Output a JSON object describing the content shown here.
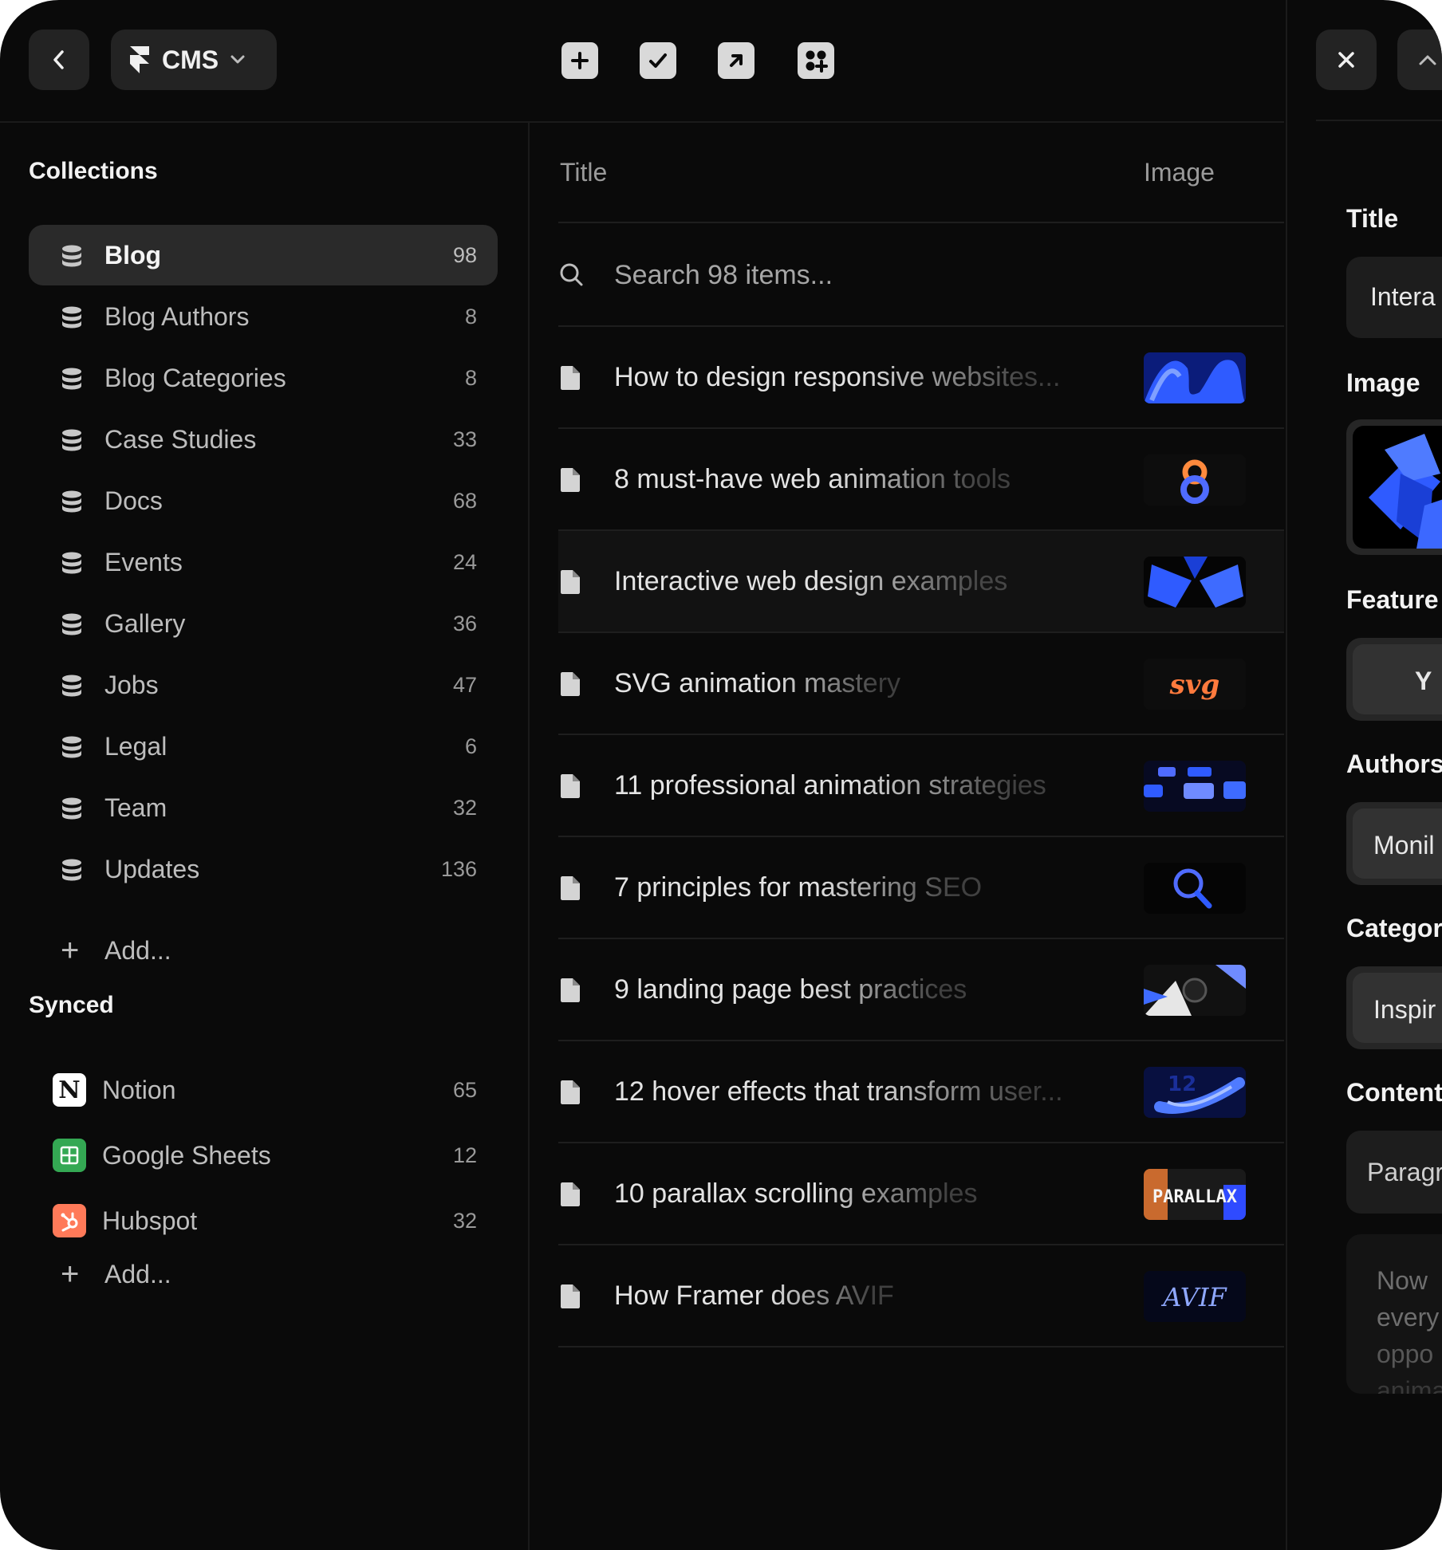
{
  "topbar": {
    "cms_label": "CMS"
  },
  "sidebar": {
    "collections_title": "Collections",
    "collections": [
      {
        "label": "Blog",
        "count": "98",
        "active": true
      },
      {
        "label": "Blog Authors",
        "count": "8"
      },
      {
        "label": "Blog Categories",
        "count": "8"
      },
      {
        "label": "Case Studies",
        "count": "33"
      },
      {
        "label": "Docs",
        "count": "68"
      },
      {
        "label": "Events",
        "count": "24"
      },
      {
        "label": "Gallery",
        "count": "36"
      },
      {
        "label": "Jobs",
        "count": "47"
      },
      {
        "label": "Legal",
        "count": "6"
      },
      {
        "label": "Team",
        "count": "32"
      },
      {
        "label": "Updates",
        "count": "136"
      }
    ],
    "add_collection_label": "Add...",
    "synced_title": "Synced",
    "synced": [
      {
        "label": "Notion",
        "count": "65",
        "icon": "notion-icon"
      },
      {
        "label": "Google Sheets",
        "count": "12",
        "icon": "google-sheets-icon"
      },
      {
        "label": "Hubspot",
        "count": "32",
        "icon": "hubspot-icon"
      }
    ],
    "add_synced_label": "Add..."
  },
  "main": {
    "columns": {
      "title": "Title",
      "image": "Image"
    },
    "search_placeholder": "Search 98 items...",
    "items": [
      {
        "title": "How to design responsive websites..."
      },
      {
        "title": "8 must-have web animation tools"
      },
      {
        "title": "Interactive web design examples",
        "highlighted": true
      },
      {
        "title": "SVG animation mastery"
      },
      {
        "title": "11 professional animation strategies"
      },
      {
        "title": "7 principles for mastering SEO"
      },
      {
        "title": "9 landing page best practices"
      },
      {
        "title": "12 hover effects that transform user..."
      },
      {
        "title": "10 parallax scrolling examples"
      },
      {
        "title": "How Framer does AVIF"
      }
    ],
    "thumb_texts": {
      "svg": "svg",
      "parallax": "PARALLAX",
      "avif": "AVIF"
    }
  },
  "detail": {
    "title_label": "Title",
    "title_value": "Intera",
    "image_label": "Image",
    "featured_label": "Feature",
    "featured_value": "Y",
    "authors_label": "Authors",
    "authors_value": "Monil",
    "category_label": "Categor",
    "category_value": "Inspir",
    "content_label": "Content",
    "content_format": "Paragr",
    "content_lines": [
      "Now",
      "every",
      "oppo",
      "anima"
    ]
  },
  "colors": {
    "background": "#0a0a0a",
    "panel_active": "#2a2a2a",
    "accent_blue": "#2f5bff",
    "notion_bg": "#ffffff",
    "sheets_green": "#34a853",
    "hubspot_orange": "#ff7a59"
  }
}
